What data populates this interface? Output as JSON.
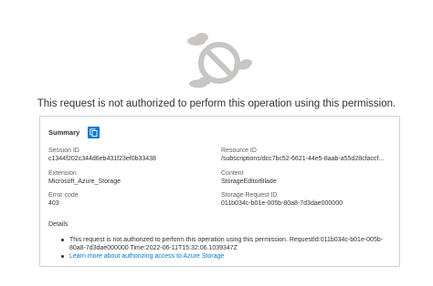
{
  "headline": "This request is not authorized to perform this operation using this permission.",
  "summary": {
    "label": "Summary"
  },
  "fields": {
    "session_id": {
      "label": "Session ID",
      "value": "c1344f202c344d6eb431f23ef0b33438"
    },
    "resource_id": {
      "label": "Resource ID",
      "value": "/subscriptions/dcc7bc52-6621-44e5-8aab-a55d28cfaccf..."
    },
    "extension": {
      "label": "Extension",
      "value": "Microsoft_Azure_Storage"
    },
    "content": {
      "label": "Content",
      "value": "StorageEditorBlade"
    },
    "error_code": {
      "label": "Error code",
      "value": "403"
    },
    "storage_request_id": {
      "label": "Storage Request ID",
      "value": "011b034c-b01e-005b-80a8-7d3dae000000"
    }
  },
  "details": {
    "title": "Details",
    "message_line1": "This request is not authorized to perform this operation using this permission. RequestId:011b034c-b01e-005b-",
    "message_line2": "80a8-7d3dae000000 Time:2022-06-11T15:32:06.1039347Z",
    "link_text": "Learn more about authorizing access to Azure Storage"
  },
  "colors": {
    "accent": "#0078d4",
    "icon_gray": "#c8c6c4",
    "text": "#323130"
  }
}
